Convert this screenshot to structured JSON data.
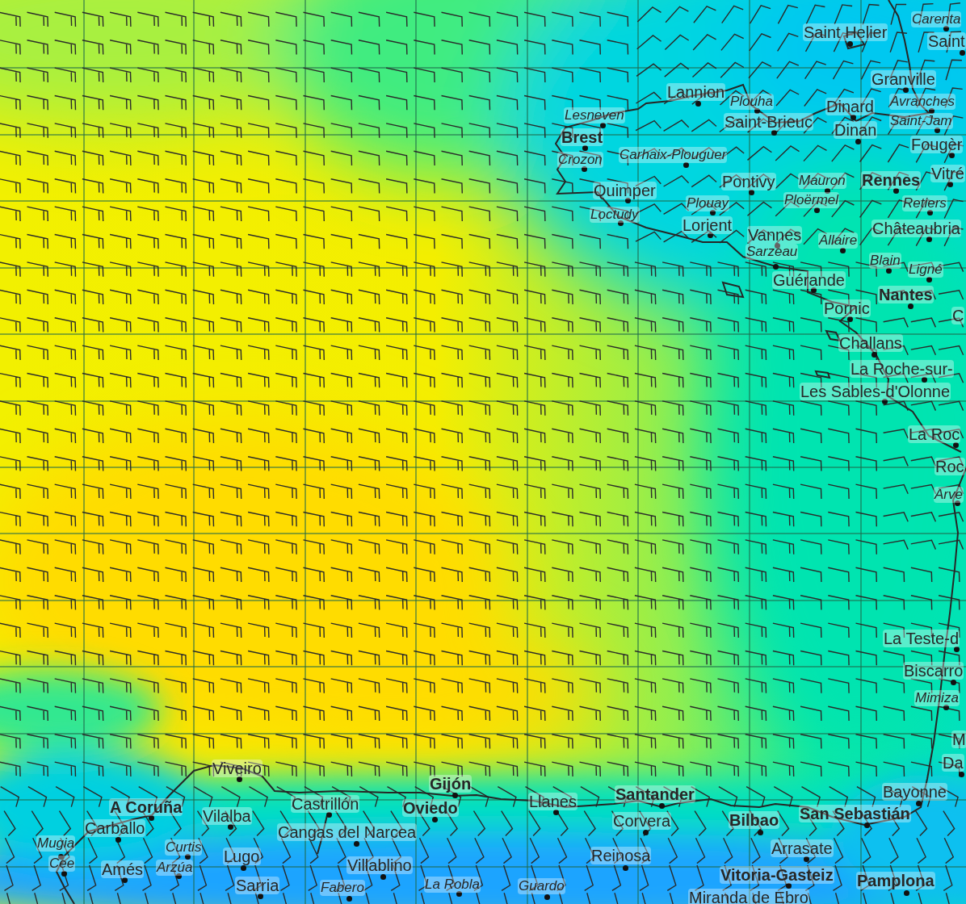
{
  "map": {
    "places": [
      {
        "name": "Saint Helier",
        "kind": "city"
      },
      {
        "name": "Carenta",
        "kind": "town"
      },
      {
        "name": "Saint",
        "kind": "city"
      },
      {
        "name": "Granville",
        "kind": "city"
      },
      {
        "name": "Lannion",
        "kind": "city"
      },
      {
        "name": "Plouha",
        "kind": "town"
      },
      {
        "name": "Dinard",
        "kind": "city"
      },
      {
        "name": "Avranches",
        "kind": "town"
      },
      {
        "name": "Lesneven",
        "kind": "town"
      },
      {
        "name": "Saint-Brieuc",
        "kind": "city"
      },
      {
        "name": "Saint-Jam",
        "kind": "town"
      },
      {
        "name": "Dinan",
        "kind": "city"
      },
      {
        "name": "Brest",
        "kind": "major"
      },
      {
        "name": "Fougèr",
        "kind": "city"
      },
      {
        "name": "Crozon",
        "kind": "town"
      },
      {
        "name": "Carhaix-Plouguer",
        "kind": "town"
      },
      {
        "name": "Pontivy",
        "kind": "city"
      },
      {
        "name": "Mauron",
        "kind": "town"
      },
      {
        "name": "Rennes",
        "kind": "major"
      },
      {
        "name": "Vitré",
        "kind": "city"
      },
      {
        "name": "Quimper",
        "kind": "city"
      },
      {
        "name": "Plouay",
        "kind": "town"
      },
      {
        "name": "Ploërmel",
        "kind": "town"
      },
      {
        "name": "Retiers",
        "kind": "town"
      },
      {
        "name": "Loctudy",
        "kind": "town"
      },
      {
        "name": "Lorient",
        "kind": "city"
      },
      {
        "name": "Châteaubria",
        "kind": "city"
      },
      {
        "name": "Vannes",
        "kind": "city"
      },
      {
        "name": "Allaire",
        "kind": "town"
      },
      {
        "name": "Sarzeau",
        "kind": "town"
      },
      {
        "name": "Blain",
        "kind": "town"
      },
      {
        "name": "Ligné",
        "kind": "town"
      },
      {
        "name": "Guérande",
        "kind": "city"
      },
      {
        "name": "Nantes",
        "kind": "major"
      },
      {
        "name": "C",
        "kind": "city"
      },
      {
        "name": "Pornic",
        "kind": "city"
      },
      {
        "name": "Challans",
        "kind": "city"
      },
      {
        "name": "La Roche-sur-",
        "kind": "city"
      },
      {
        "name": "Les Sables-d'Olonne",
        "kind": "city"
      },
      {
        "name": "La Roc",
        "kind": "city"
      },
      {
        "name": "Roc",
        "kind": "city"
      },
      {
        "name": "Arve",
        "kind": "town"
      },
      {
        "name": "La Teste-d",
        "kind": "city"
      },
      {
        "name": "Biscarro",
        "kind": "city"
      },
      {
        "name": "Mimiza",
        "kind": "town"
      },
      {
        "name": "M",
        "kind": "city"
      },
      {
        "name": "Da",
        "kind": "city"
      },
      {
        "name": "Viveiro",
        "kind": "city"
      },
      {
        "name": "Gijón",
        "kind": "major"
      },
      {
        "name": "Santander",
        "kind": "major"
      },
      {
        "name": "Bayonne",
        "kind": "city"
      },
      {
        "name": "A Coruña",
        "kind": "major"
      },
      {
        "name": "Castrillón",
        "kind": "city"
      },
      {
        "name": "Llanes",
        "kind": "city"
      },
      {
        "name": "Oviedo",
        "kind": "major"
      },
      {
        "name": "Vilalba",
        "kind": "city"
      },
      {
        "name": "San Sebastián",
        "kind": "major"
      },
      {
        "name": "Bilbao",
        "kind": "major"
      },
      {
        "name": "Carballo",
        "kind": "city"
      },
      {
        "name": "Corvera",
        "kind": "city"
      },
      {
        "name": "Cangas del Narcea",
        "kind": "city"
      },
      {
        "name": "Mugia",
        "kind": "town"
      },
      {
        "name": "Curtis",
        "kind": "town"
      },
      {
        "name": "Arrasate",
        "kind": "city"
      },
      {
        "name": "Lugo",
        "kind": "city"
      },
      {
        "name": "Reinosa",
        "kind": "city"
      },
      {
        "name": "Cee",
        "kind": "town"
      },
      {
        "name": "Amés",
        "kind": "city"
      },
      {
        "name": "Arzúa",
        "kind": "town"
      },
      {
        "name": "Villablino",
        "kind": "city"
      },
      {
        "name": "Sarria",
        "kind": "city"
      },
      {
        "name": "Fabero",
        "kind": "town"
      },
      {
        "name": "La Robla",
        "kind": "town"
      },
      {
        "name": "Guardo",
        "kind": "town"
      },
      {
        "name": "Vitoria-Gasteiz",
        "kind": "major"
      },
      {
        "name": "Pamplona",
        "kind": "major"
      },
      {
        "name": "Miranda de Ebro",
        "kind": "city"
      }
    ]
  }
}
